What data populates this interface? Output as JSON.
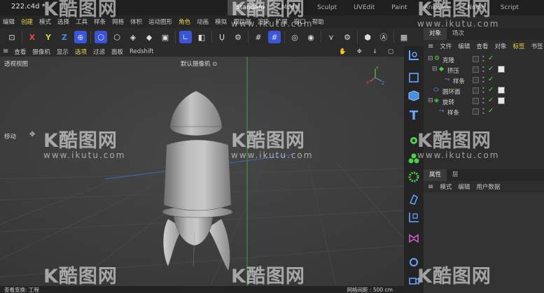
{
  "titlebar": {
    "file_tab": "222.c4d *",
    "layouts": [
      "Standard",
      "Model",
      "Sculpt",
      "UVEdit",
      "Paint",
      "Animate",
      "Node",
      "Script"
    ],
    "active_layout": "Standard"
  },
  "menubar": {
    "items": [
      "编辑",
      "创建",
      "模式",
      "选择",
      "工具",
      "样条",
      "网格",
      "体积",
      "运动图形",
      "角色",
      "动画",
      "模拟",
      "跟踪器",
      "渲染",
      "扩展",
      "窗口",
      "帮助"
    ]
  },
  "toolbar": {
    "axis_x": "X",
    "axis_y": "Y",
    "axis_z": "Z"
  },
  "viewport_menu": {
    "items": [
      "查看",
      "摄像机",
      "显示",
      "选项",
      "过滤",
      "面板",
      "Redshift"
    ],
    "highlight": "选项"
  },
  "viewport": {
    "label": "透视视图",
    "camera": "默认摄像机 ⊙",
    "move_label": "移动",
    "gizmo": {
      "x": "X",
      "y": "Y",
      "z": "Z"
    }
  },
  "statusbar": {
    "left": "查看变换: 工程",
    "right": "网格间距 : 500 cm"
  },
  "objects_panel": {
    "tabs": [
      "对象",
      "场次"
    ],
    "menu": [
      "文件",
      "编辑",
      "查看",
      "对象",
      "标签",
      "书签"
    ],
    "menu_highlight": "标签",
    "rows": [
      {
        "name": "克隆",
        "icon": "cloner-icon",
        "depth": 0
      },
      {
        "name": "挤压",
        "icon": "extrude-icon",
        "depth": 1
      },
      {
        "name": "样条",
        "icon": "spline-icon",
        "depth": 2
      },
      {
        "name": "圆环面",
        "icon": "torus-icon",
        "depth": 0
      },
      {
        "name": "旋转",
        "icon": "lathe-icon",
        "depth": 0
      },
      {
        "name": "样条",
        "icon": "spline-icon",
        "depth": 1
      }
    ]
  },
  "attributes_panel": {
    "tabs": [
      "属性",
      "层"
    ],
    "menu": [
      "模式",
      "编辑",
      "用户数据"
    ]
  },
  "watermark": {
    "logo": "K酷图网",
    "url": "www.ikutu.com"
  },
  "colors": {
    "accent_blue": "#3b55d9",
    "highlight_yellow": "#e7d44a",
    "check_green": "#52d15a",
    "axis_red": "#e04a4a",
    "axis_green": "#4cd04c",
    "axis_blue": "#4a8ee0"
  }
}
